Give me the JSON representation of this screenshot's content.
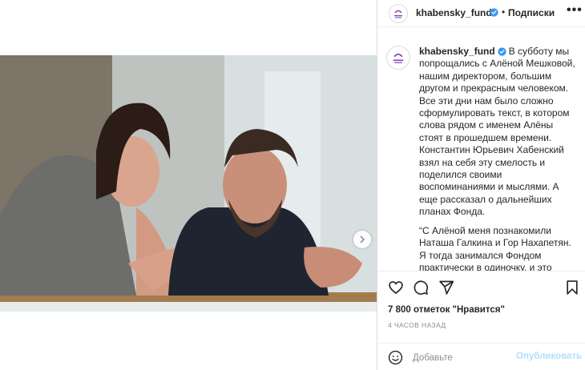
{
  "account": {
    "username": "khabensky_fund",
    "avatar_text": "Фонд Хабенского",
    "verified": true
  },
  "header": {
    "dot": "•",
    "follow_label": "Подписки",
    "more_label": "•••"
  },
  "caption": {
    "paragraph1": "В субботу мы попрощались с Алёной Мешковой, нашим директором, большим другом и прекрасным человеком. Все эти дни нам было сложно сформулировать текст, в котором слова рядом с именем Алёны стоят в прошедшем времени. Константин Юрьевич Хабенский взял на себя эту смелость и поделился своими воспоминаниями и мыслями. А еще рассказал о дальнейших планах Фонда.",
    "paragraph2": "“С Алёной меня познакомили Наташа Галкина и Гор Нахапетян. Я тогда занимался Фондом практически в одиночку, и это была, в основном, адресная помощь."
  },
  "stats": {
    "likes": "7 800 отметок \"Нравится\"",
    "time_ago": "4 ЧАСОВ НАЗАД"
  },
  "comment": {
    "placeholder": "Добавьте",
    "post_label": "Опубликовать"
  },
  "icons": {
    "verified": "verified-badge-icon",
    "like": "heart-icon",
    "comment": "comment-bubble-icon",
    "share": "paper-plane-icon",
    "save": "bookmark-icon",
    "emoji": "smiley-icon",
    "next": "chevron-right-icon"
  },
  "colors": {
    "verified": "#3897f0",
    "post_disabled": "#b2dffc",
    "muted": "#8e8e8e",
    "avatar_accent": "#8a3fb8"
  }
}
